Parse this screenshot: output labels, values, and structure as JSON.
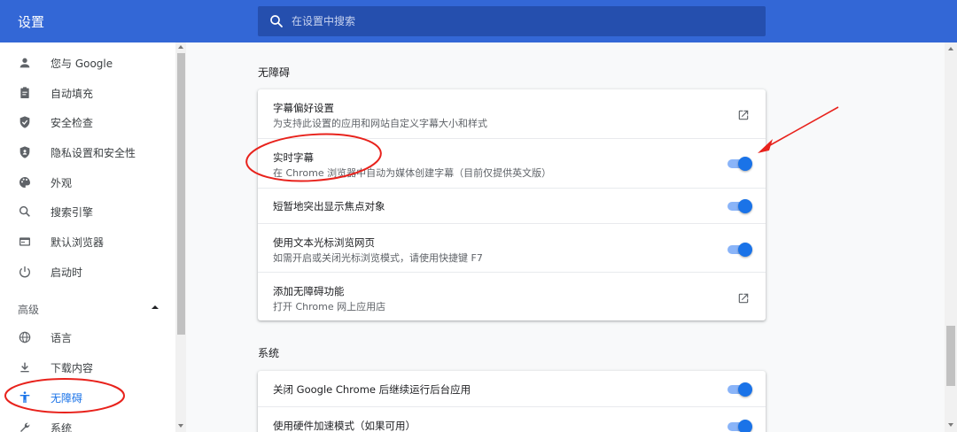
{
  "header": {
    "title": "设置",
    "search_placeholder": "在设置中搜索"
  },
  "sidebar": {
    "items": [
      {
        "label": "您与 Google",
        "icon": "person-icon"
      },
      {
        "label": "自动填充",
        "icon": "clipboard-icon"
      },
      {
        "label": "安全检查",
        "icon": "shield-check-icon"
      },
      {
        "label": "隐私设置和安全性",
        "icon": "shield-icon"
      },
      {
        "label": "外观",
        "icon": "palette-icon"
      },
      {
        "label": "搜索引擎",
        "icon": "search-icon"
      },
      {
        "label": "默认浏览器",
        "icon": "browser-icon"
      },
      {
        "label": "启动时",
        "icon": "power-icon"
      }
    ],
    "advanced_label": "高级",
    "advanced_items": [
      {
        "label": "语言",
        "icon": "globe-icon"
      },
      {
        "label": "下载内容",
        "icon": "download-icon"
      },
      {
        "label": "无障碍",
        "icon": "accessibility-icon",
        "active": true
      },
      {
        "label": "系统",
        "icon": "wrench-icon"
      }
    ]
  },
  "accessibility": {
    "title": "无障碍",
    "rows": [
      {
        "title": "字幕偏好设置",
        "subtitle": "为支持此设置的应用和网站自定义字幕大小和样式",
        "control": "external-link"
      },
      {
        "title": "实时字幕",
        "subtitle": "在 Chrome 浏览器中自动为媒体创建字幕（目前仅提供英文版）",
        "control": "toggle",
        "on": true
      },
      {
        "title": "短暂地突出显示焦点对象",
        "subtitle": "",
        "control": "toggle",
        "on": true
      },
      {
        "title": "使用文本光标浏览网页",
        "subtitle": "如需开启或关闭光标浏览模式，请使用快捷键 F7",
        "control": "toggle",
        "on": true
      },
      {
        "title": "添加无障碍功能",
        "subtitle": "打开 Chrome 网上应用店",
        "control": "external-link"
      }
    ]
  },
  "system": {
    "title": "系统",
    "rows": [
      {
        "title": "关闭 Google Chrome 后继续运行后台应用",
        "control": "toggle",
        "on": true
      },
      {
        "title": "使用硬件加速模式（如果可用）",
        "control": "toggle",
        "on": true
      }
    ]
  },
  "colors": {
    "header_bg": "#3367d6",
    "accent": "#1a73e8",
    "annotation": "#e8221c"
  }
}
